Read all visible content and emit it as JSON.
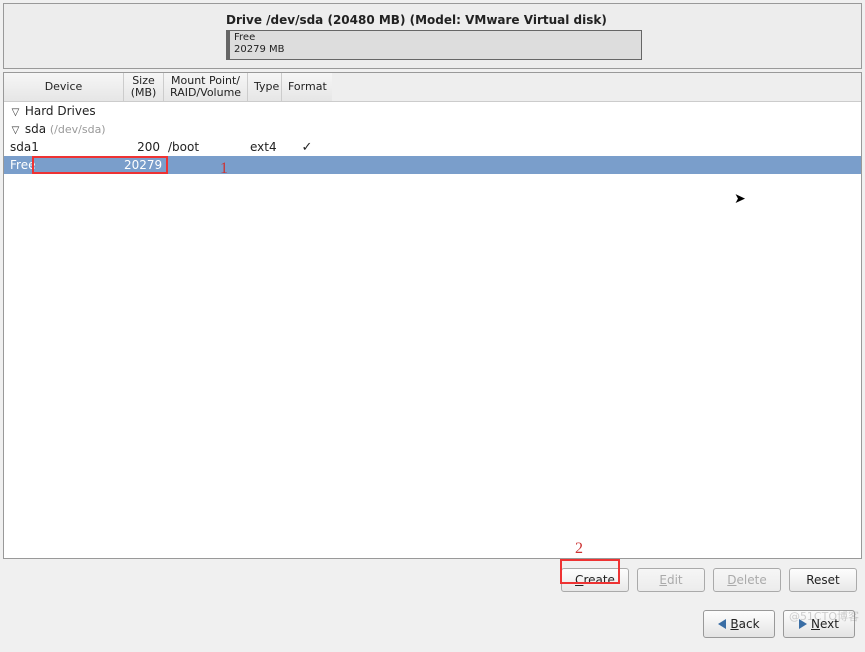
{
  "drive_header": {
    "title": "Drive /dev/sda (20480 MB) (Model: VMware Virtual disk)",
    "segment": {
      "name": "Free",
      "size_line": "20279 MB"
    }
  },
  "columns": {
    "device": "Device",
    "size_line1": "Size",
    "size_line2": "(MB)",
    "mount_line1": "Mount Point/",
    "mount_line2": "RAID/Volume",
    "type": "Type",
    "format": "Format"
  },
  "tree": {
    "root_label": "Hard Drives",
    "disk": {
      "name": "sda",
      "path_hint": "(/dev/sda)"
    },
    "rows": [
      {
        "device": "sda1",
        "size": "200",
        "mount": "/boot",
        "type": "ext4",
        "format_check": "✓"
      },
      {
        "device": "Free",
        "size": "20279",
        "mount": "",
        "type": "",
        "format_check": ""
      }
    ]
  },
  "annotations": {
    "label1": "1",
    "label2": "2"
  },
  "buttons": {
    "create": "Create",
    "edit": "Edit",
    "delete": "Delete",
    "reset": "Reset",
    "back": "Back",
    "next": "Next"
  },
  "watermark": "@51CTO博客"
}
